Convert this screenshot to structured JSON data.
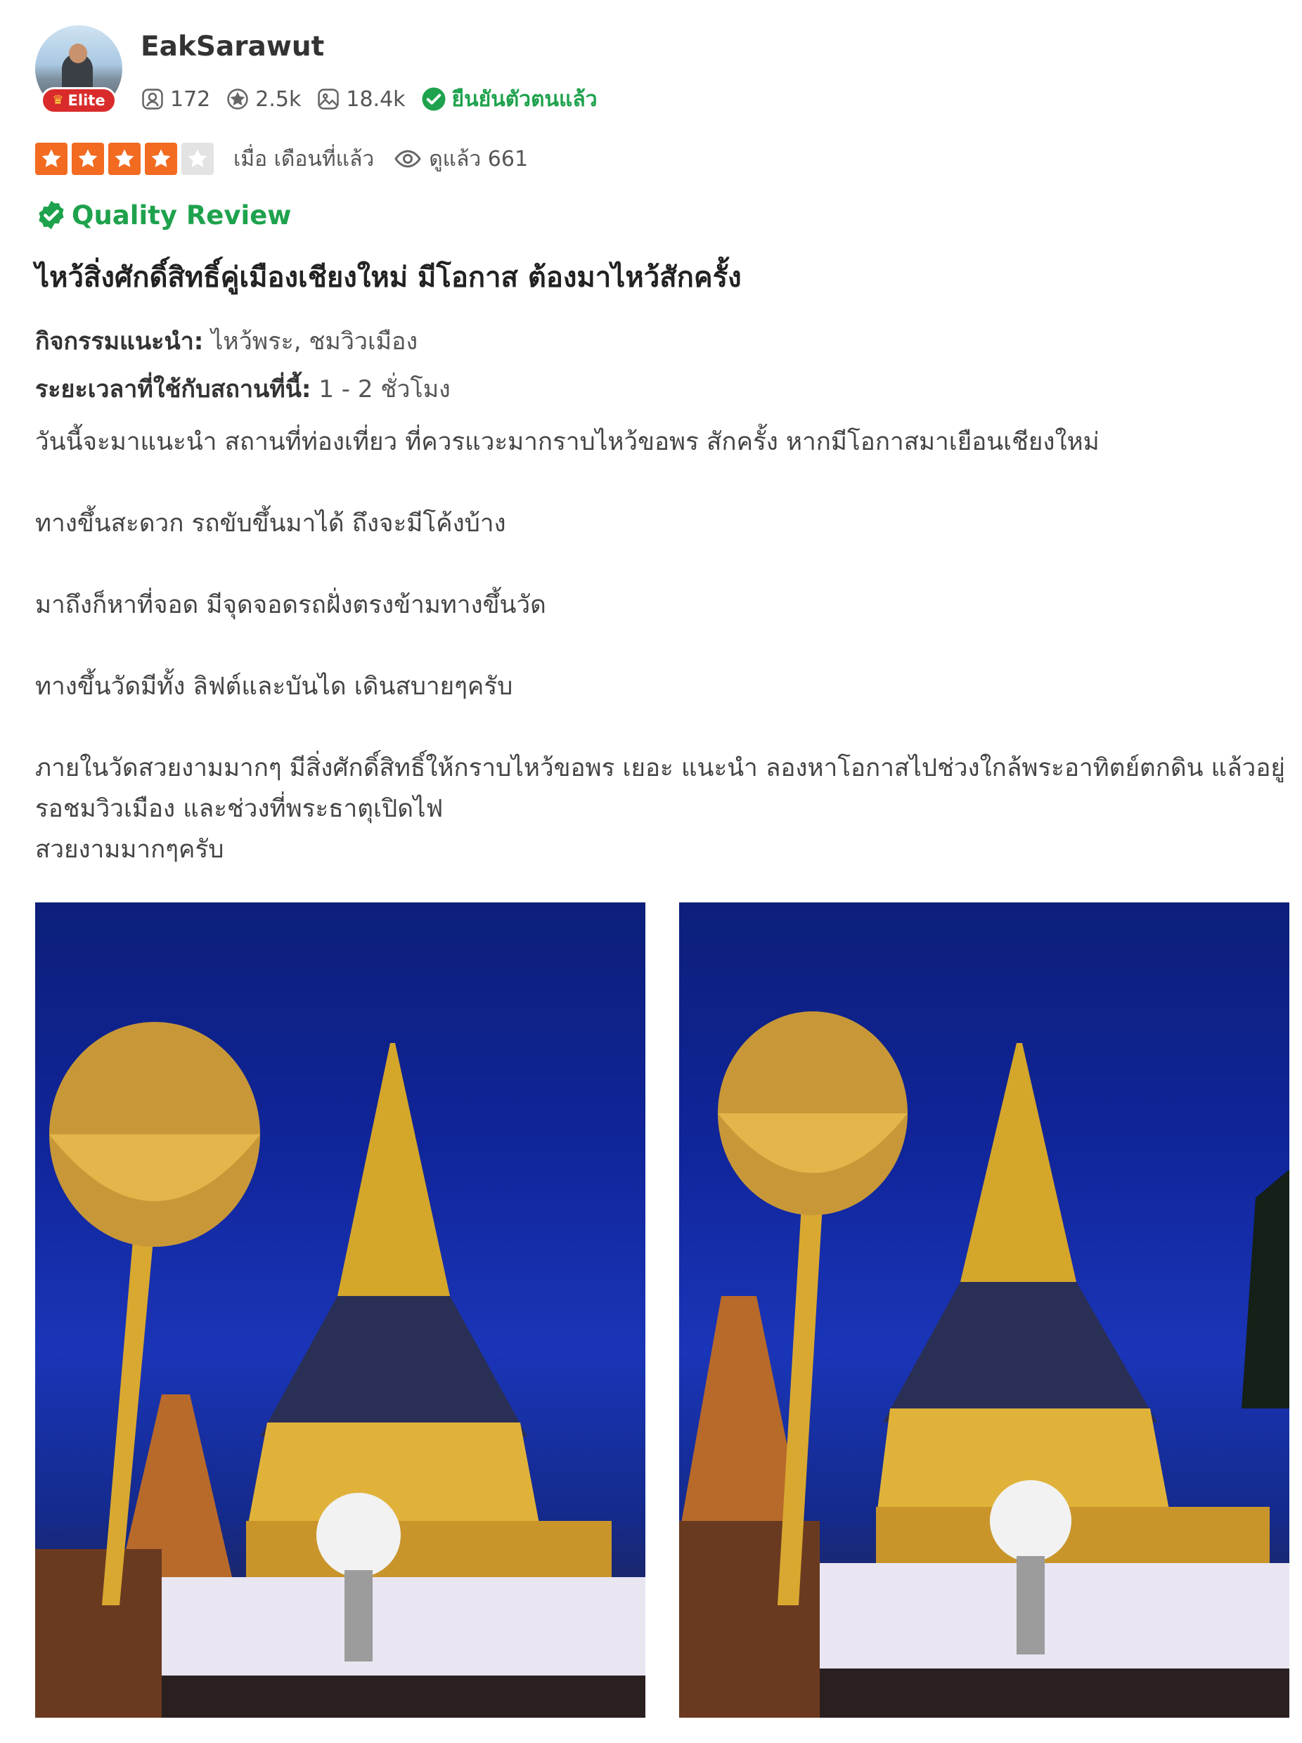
{
  "user": {
    "name": "EakSarawut",
    "badge": "Elite",
    "followers": "172",
    "reviews": "2.5k",
    "photos": "18.4k",
    "verified_label": "ยืนยันตัวตนแล้ว"
  },
  "review": {
    "rating": 4,
    "rating_max": 5,
    "time": "เมื่อ เดือนที่แล้ว",
    "views": "ดูแล้ว 661",
    "quality_label": "Quality Review",
    "title": "ไหว้สิ่งศักดิ์สิทธิ์คู่เมืองเชียงใหม่ มีโอกาส ต้องมาไหว้สักครั้ง",
    "activities_label": "กิจกรรมแนะนำ:",
    "activities_value": " ไหว้พระ, ชมวิวเมือง",
    "duration_label": "ระยะเวลาที่ใช้กับสถานที่นี้:",
    "duration_value": " 1 - 2 ชั่วโมง",
    "paragraphs": [
      "วันนี้จะมาแนะนำ สถานที่ท่องเที่ยว ที่ควรแวะมากราบไหว้ขอพร สักครั้ง หากมีโอกาสมาเยือนเชียงใหม่",
      "ทางขึ้นสะดวก รถขับขึ้นมาได้ ถึงจะมีโค้งบ้าง",
      "มาถึงก็หาที่จอด มีจุดจอดรถฝั่งตรงข้ามทางขึ้นวัด",
      "ทางขึ้นวัดมีทั้ง ลิฟต์และบันได เดินสบายๆครับ",
      "ภายในวัดสวยงามมากๆ มีสิ่งศักดิ์สิทธิ์ให้กราบไหว้ขอพร เยอะ แนะนำ ลองหาโอกาสไปช่วงใกล้พระอาทิตย์ตกดิน แล้วอยู่รอชมวิวเมือง และช่วงที่พระธาตุเปิดไฟ\nสวยงามมากๆครับ"
    ]
  },
  "colors": {
    "accent_orange": "#f26b21",
    "verified_green": "#1ea24d",
    "elite_red": "#d92b2b"
  }
}
